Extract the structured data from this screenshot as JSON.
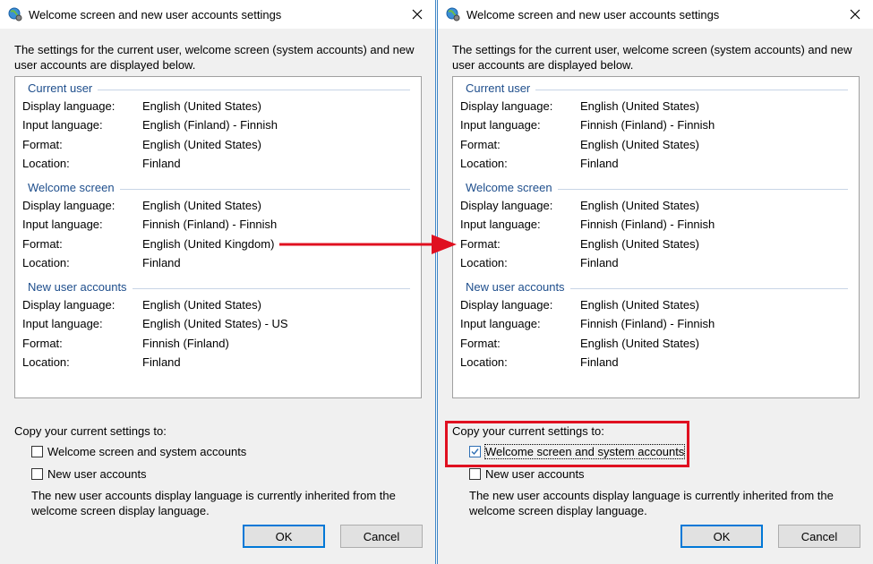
{
  "dialogs": [
    {
      "title": "Welcome screen and new user accounts settings",
      "intro": "The settings for the current user, welcome screen (system accounts) and new user accounts are displayed below.",
      "sections": [
        {
          "title": "Current user",
          "rows": [
            {
              "label": "Display language:",
              "value": "English (United States)"
            },
            {
              "label": "Input language:",
              "value": "English (Finland) - Finnish"
            },
            {
              "label": "Format:",
              "value": "English (United States)"
            },
            {
              "label": "Location:",
              "value": "Finland"
            }
          ]
        },
        {
          "title": "Welcome screen",
          "rows": [
            {
              "label": "Display language:",
              "value": "English (United States)"
            },
            {
              "label": "Input language:",
              "value": "Finnish (Finland) - Finnish"
            },
            {
              "label": "Format:",
              "value": "English (United Kingdom)"
            },
            {
              "label": "Location:",
              "value": "Finland"
            }
          ]
        },
        {
          "title": "New user accounts",
          "rows": [
            {
              "label": "Display language:",
              "value": "English (United States)"
            },
            {
              "label": "Input language:",
              "value": "English (United States) - US"
            },
            {
              "label": "Format:",
              "value": "Finnish (Finland)"
            },
            {
              "label": "Location:",
              "value": "Finland"
            }
          ]
        }
      ],
      "copy_title": "Copy your current settings to:",
      "checkbox_welcome": "Welcome screen and system accounts",
      "checkbox_welcome_checked": false,
      "checkbox_new_users": "New user accounts",
      "checkbox_new_users_checked": false,
      "note": "The new user accounts display language is currently inherited from the welcome screen display language.",
      "ok_label": "OK",
      "cancel_label": "Cancel"
    },
    {
      "title": "Welcome screen and new user accounts settings",
      "intro": "The settings for the current user, welcome screen (system accounts) and new user accounts are displayed below.",
      "sections": [
        {
          "title": "Current user",
          "rows": [
            {
              "label": "Display language:",
              "value": "English (United States)"
            },
            {
              "label": "Input language:",
              "value": "Finnish (Finland) - Finnish"
            },
            {
              "label": "Format:",
              "value": "English (United States)"
            },
            {
              "label": "Location:",
              "value": "Finland"
            }
          ]
        },
        {
          "title": "Welcome screen",
          "rows": [
            {
              "label": "Display language:",
              "value": "English (United States)"
            },
            {
              "label": "Input language:",
              "value": "Finnish (Finland) - Finnish"
            },
            {
              "label": "Format:",
              "value": "English (United States)"
            },
            {
              "label": "Location:",
              "value": "Finland"
            }
          ]
        },
        {
          "title": "New user accounts",
          "rows": [
            {
              "label": "Display language:",
              "value": "English (United States)"
            },
            {
              "label": "Input language:",
              "value": "Finnish (Finland) - Finnish"
            },
            {
              "label": "Format:",
              "value": "English (United States)"
            },
            {
              "label": "Location:",
              "value": "Finland"
            }
          ]
        }
      ],
      "copy_title": "Copy your current settings to:",
      "checkbox_welcome": "Welcome screen and system accounts",
      "checkbox_welcome_checked": true,
      "checkbox_new_users": "New user accounts",
      "checkbox_new_users_checked": false,
      "note": "The new user accounts display language is currently inherited from the welcome screen display language.",
      "ok_label": "OK",
      "cancel_label": "Cancel"
    }
  ],
  "annotations": {
    "arrow_color": "#e01020",
    "highlight_color": "#e01020"
  },
  "colors": {
    "section_title": "#1e4e8c",
    "dialog_bg": "#f0f0f0",
    "default_button_border": "#0078d7"
  },
  "icons": {
    "app": "globe-gear-icon",
    "close": "close-icon",
    "check": "check-icon"
  }
}
